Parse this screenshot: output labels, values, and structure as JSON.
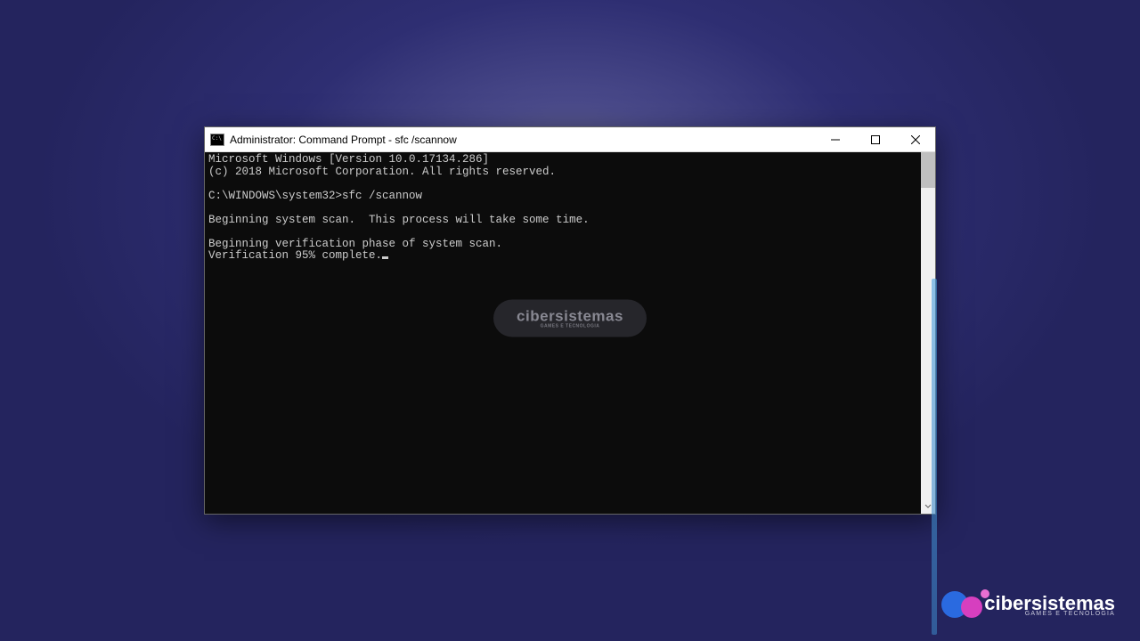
{
  "window": {
    "title": "Administrator: Command Prompt - sfc  /scannow"
  },
  "terminal": {
    "line_version": "Microsoft Windows [Version 10.0.17134.286]",
    "line_copyright": "(c) 2018 Microsoft Corporation. All rights reserved.",
    "prompt_path": "C:\\WINDOWS\\system32>",
    "command": "sfc /scannow",
    "line_beginning": "Beginning system scan.  This process will take some time.",
    "line_verification_phase": "Beginning verification phase of system scan.",
    "line_progress": "Verification 95% complete."
  },
  "watermark": {
    "main": "cibersistemas",
    "sub": "GAMES E TECNOLOGIA"
  },
  "branding": {
    "name": "cibersistemas",
    "tagline": "GAMES E TECNOLOGIA"
  }
}
